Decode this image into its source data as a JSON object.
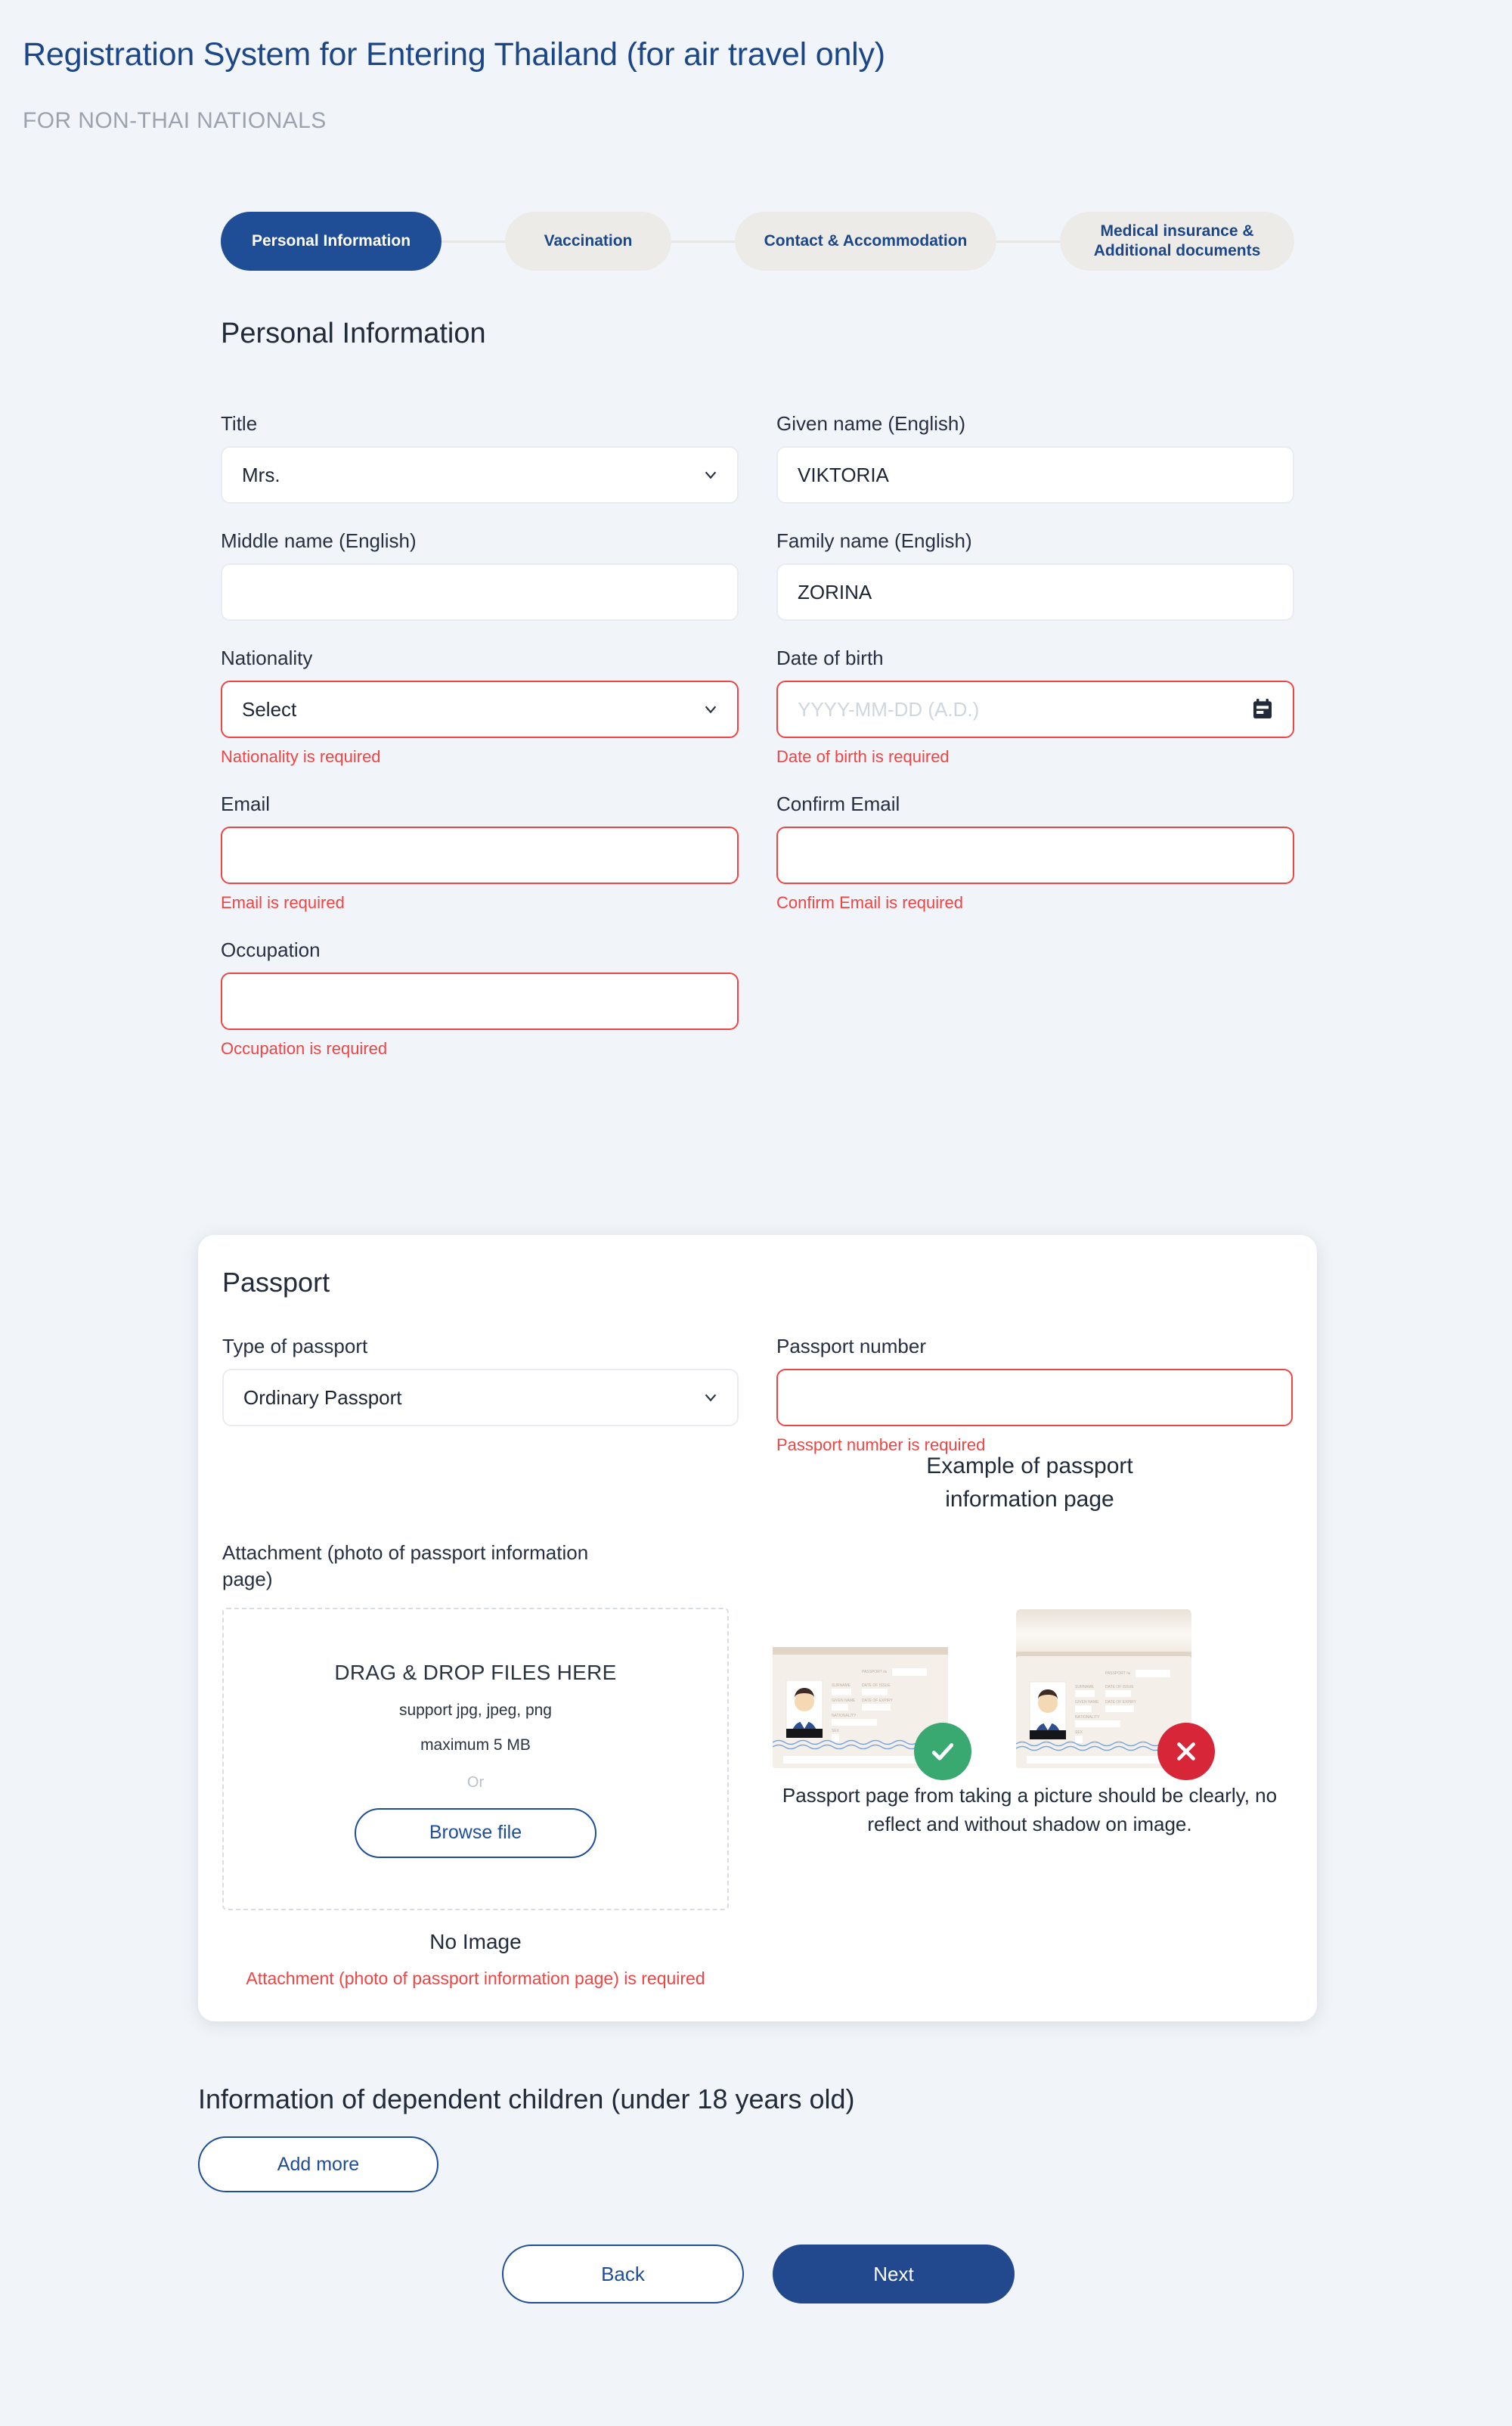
{
  "header": {
    "title": "Registration System for Entering Thailand (for air travel only)",
    "subtitle": "FOR NON-THAI NATIONALS"
  },
  "stepper": {
    "steps": [
      {
        "label": "Personal Information",
        "active": true
      },
      {
        "label": "Vaccination",
        "active": false
      },
      {
        "label": "Contact & Accommodation",
        "active": false
      },
      {
        "label": "Medical insurance & Additional documents",
        "active": false
      }
    ],
    "step4_line1": "Medical insurance &",
    "step4_line2": "Additional documents"
  },
  "section": {
    "title": "Personal Information"
  },
  "fields": {
    "title": {
      "label": "Title",
      "value": "Mrs.",
      "error": ""
    },
    "given_name": {
      "label": "Given name (English)",
      "value": "VIKTORIA",
      "error": ""
    },
    "middle_name": {
      "label": "Middle name (English)",
      "value": "",
      "error": ""
    },
    "family_name": {
      "label": "Family name (English)",
      "value": "ZORINA",
      "error": ""
    },
    "nationality": {
      "label": "Nationality",
      "value": "Select",
      "error": "Nationality is required"
    },
    "date_of_birth": {
      "label": "Date of birth",
      "value": "",
      "placeholder": "YYYY-MM-DD (A.D.)",
      "error": "Date of birth is required"
    },
    "email": {
      "label": "Email",
      "value": "",
      "error": "Email is required"
    },
    "confirm_email": {
      "label": "Confirm Email",
      "value": "",
      "error": "Confirm Email is required"
    },
    "occupation": {
      "label": "Occupation",
      "value": "",
      "error": "Occupation is required"
    }
  },
  "passport": {
    "card_title": "Passport",
    "type_label": "Type of passport",
    "type_value": "Ordinary Passport",
    "number_label": "Passport number",
    "number_value": "",
    "number_error": "Passport number is required",
    "attachment_label": "Attachment (photo of passport information page)",
    "drop_main": "DRAG & DROP FILES HERE",
    "drop_support": "support jpg, jpeg, png",
    "drop_max": "maximum 5 MB",
    "drop_or": "Or",
    "browse_label": "Browse file",
    "no_image": "No Image",
    "attachment_error": "Attachment (photo of passport information page) is required",
    "example_title_line1": "Example of passport",
    "example_title_line2": "information page",
    "example_caption": "Passport page from taking a picture should be clearly, no reflect and without shadow on image.",
    "good_badge": "check-mark",
    "bad_badge": "cross-mark",
    "sample_fields": [
      "PASSPORT №",
      "SURNAME",
      "DATE OF ISSUE",
      "GIVEN NAME",
      "DATE OF EXPIRY",
      "NATIONALITY",
      "SEX"
    ]
  },
  "children": {
    "title": "Information of dependent children (under 18 years old)",
    "add_more_label": "Add more"
  },
  "footer": {
    "back_label": "Back",
    "next_label": "Next"
  },
  "colors": {
    "page_bg": "#f1f5f9",
    "brand_blue": "#1b4788",
    "active_step": "#1f4e97",
    "inactive_step": "#ecebe8",
    "error_red": "#ef4444",
    "badge_green": "#3aa871",
    "badge_red": "#d72638"
  }
}
